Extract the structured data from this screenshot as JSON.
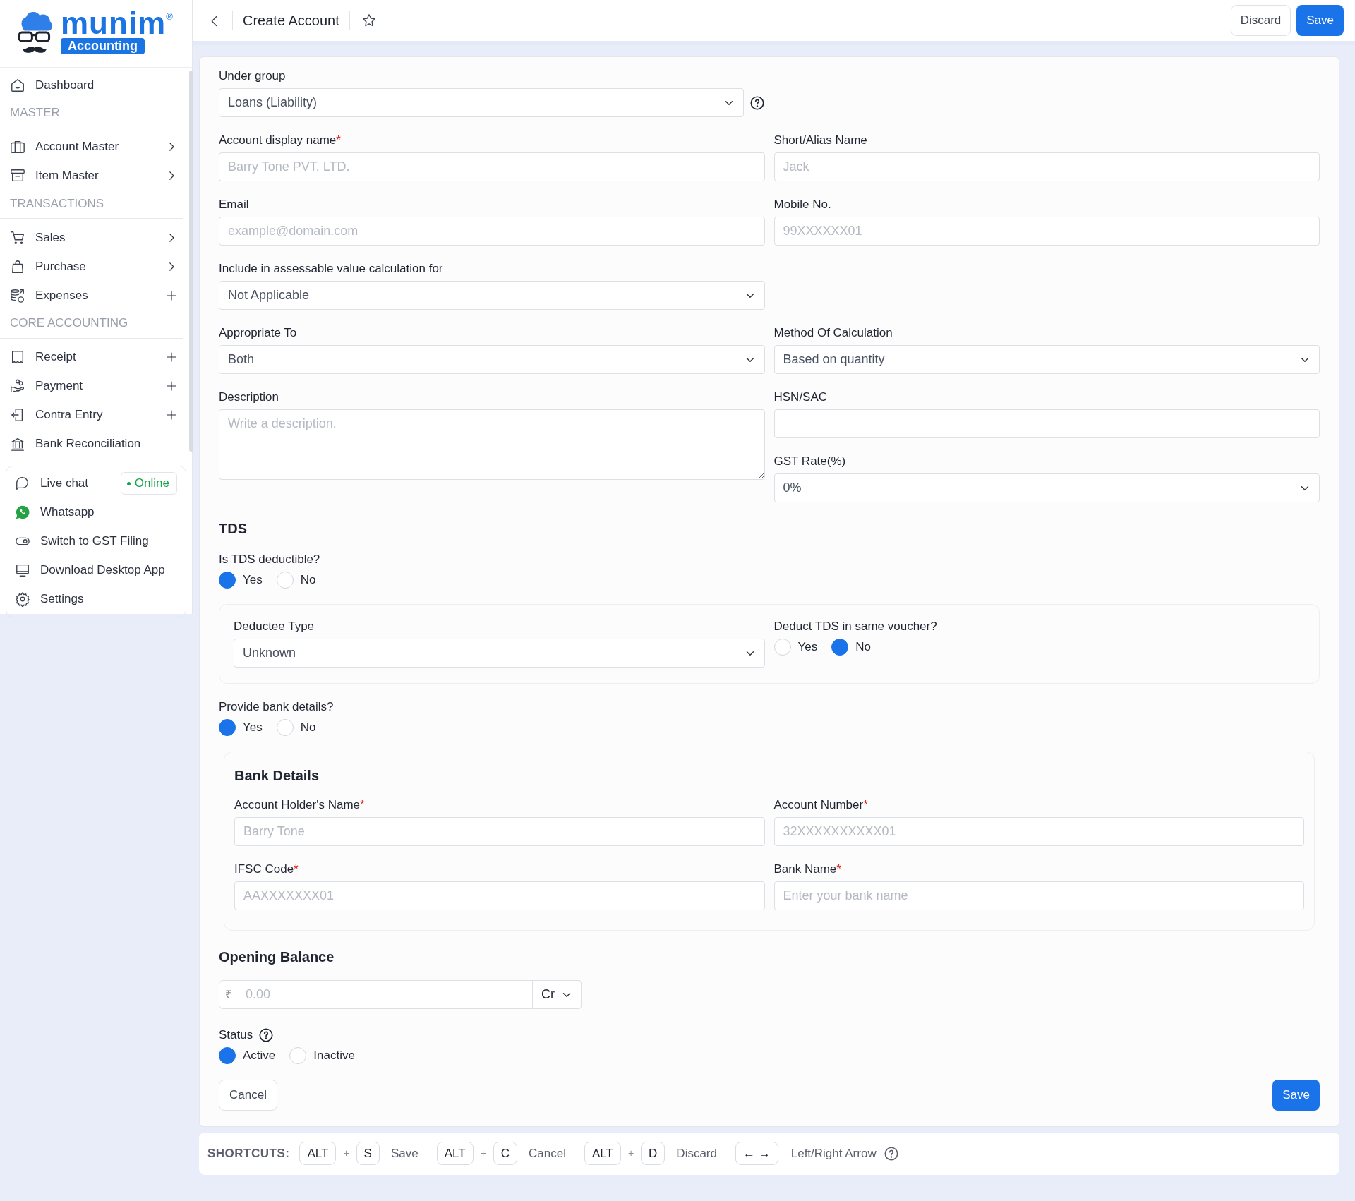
{
  "logo": {
    "wordmark": "munim",
    "registered": "®",
    "tagline": "Accounting"
  },
  "sidebar": {
    "items": [
      {
        "kind": "link",
        "label": "Dashboard"
      },
      {
        "kind": "section",
        "label": "MASTER"
      },
      {
        "kind": "link",
        "label": "Account Master",
        "submenu": true
      },
      {
        "kind": "link",
        "label": "Item Master",
        "submenu": true
      },
      {
        "kind": "section",
        "label": "TRANSACTIONS"
      },
      {
        "kind": "link",
        "label": "Sales",
        "submenu": true
      },
      {
        "kind": "link",
        "label": "Purchase",
        "submenu": true
      },
      {
        "kind": "link",
        "label": "Expenses",
        "quick_add": true
      },
      {
        "kind": "section",
        "label": "CORE ACCOUNTING"
      },
      {
        "kind": "link",
        "label": "Receipt",
        "quick_add": true
      },
      {
        "kind": "link",
        "label": "Payment",
        "quick_add": true
      },
      {
        "kind": "link",
        "label": "Contra Entry",
        "quick_add": true
      },
      {
        "kind": "link",
        "label": "Bank Reconciliation"
      }
    ],
    "support": [
      {
        "label": "Live chat",
        "badge": "Online"
      },
      {
        "label": "Whatsapp"
      },
      {
        "label": "Switch to GST Filing"
      },
      {
        "label": "Download Desktop App"
      },
      {
        "label": "Settings"
      }
    ]
  },
  "header": {
    "title": "Create Account",
    "starred": false,
    "buttons": [
      {
        "label": "Discard",
        "kind": "secondary"
      },
      {
        "label": "Save",
        "kind": "primary"
      }
    ]
  },
  "form": {
    "blocks": [
      {
        "kind": "grid",
        "rows": [
          [
            [
              {
                "kind": "select",
                "label": "Under group",
                "value": "Loans (Liability)",
                "help": true
              }
            ],
            []
          ],
          [
            [
              {
                "kind": "input",
                "label": "Account display name",
                "required_mark": "*",
                "placeholder": "Barry Tone PVT. LTD."
              }
            ],
            [
              {
                "kind": "input",
                "label": "Short/Alias Name",
                "placeholder": "Jack"
              }
            ]
          ],
          [
            [
              {
                "kind": "input",
                "label": "Email",
                "placeholder": "example@domain.com"
              }
            ],
            [
              {
                "kind": "input",
                "label": "Mobile No.",
                "placeholder": "99XXXXXX01"
              }
            ]
          ],
          [
            [
              {
                "kind": "select",
                "label": "Include in assessable value calculation for",
                "value": "Not Applicable"
              }
            ],
            []
          ],
          [
            [
              {
                "kind": "select",
                "label": "Appropriate To",
                "value": "Both"
              }
            ],
            [
              {
                "kind": "select",
                "label": "Method Of Calculation",
                "value": "Based on quantity"
              }
            ]
          ],
          [
            [
              {
                "kind": "textarea",
                "label": "Description",
                "placeholder": "Write a description."
              }
            ],
            [
              {
                "kind": "input",
                "label": "HSN/SAC"
              },
              {
                "kind": "select",
                "label": "GST Rate(%)",
                "value": "0%"
              }
            ]
          ]
        ]
      },
      {
        "kind": "heading",
        "text": "TDS"
      },
      {
        "kind": "radio",
        "label": "Is TDS deductible?",
        "options": [
          {
            "label": "Yes",
            "selected": true
          },
          {
            "label": "No",
            "selected": false
          }
        ]
      },
      {
        "kind": "panel",
        "rows": [
          [
            [
              {
                "kind": "select",
                "label": "Deductee Type",
                "value": "Unknown"
              }
            ],
            [
              {
                "kind": "radio",
                "label": "Deduct TDS in same voucher?",
                "options": [
                  {
                    "label": "Yes",
                    "selected": false
                  },
                  {
                    "label": "No",
                    "selected": true
                  }
                ]
              }
            ]
          ]
        ]
      },
      {
        "kind": "radio",
        "label": "Provide bank details?",
        "options": [
          {
            "label": "Yes",
            "selected": true
          },
          {
            "label": "No",
            "selected": false
          }
        ]
      },
      {
        "kind": "panel",
        "title": "Bank Details",
        "rows": [
          [
            [
              {
                "kind": "input",
                "label": "Account Holder's Name",
                "required_mark": "*",
                "placeholder": "Barry Tone"
              }
            ],
            [
              {
                "kind": "input",
                "label": "Account Number",
                "required_mark": "*",
                "placeholder": "32XXXXXXXXXX01"
              }
            ]
          ],
          [
            [
              {
                "kind": "input",
                "label": "IFSC Code",
                "required_mark": "*",
                "placeholder": "AAXXXXXXX01"
              }
            ],
            [
              {
                "kind": "input",
                "label": "Bank Name",
                "required_mark": "*",
                "placeholder": "Enter your bank name"
              }
            ]
          ]
        ]
      },
      {
        "kind": "heading",
        "text": "Opening Balance"
      },
      {
        "kind": "amount",
        "prefix": "₹",
        "placeholder": "0.00",
        "type_value": "Cr"
      },
      {
        "kind": "radio",
        "label": "Status",
        "help": true,
        "options": [
          {
            "label": "Active",
            "selected": true
          },
          {
            "label": "Inactive",
            "selected": false
          }
        ]
      }
    ],
    "buttons": [
      {
        "label": "Cancel",
        "kind": "secondary"
      },
      {
        "label": "Save",
        "kind": "primary"
      }
    ]
  },
  "shortcuts": {
    "label": "SHORTCUTS:",
    "items": [
      {
        "parts": [
          {
            "kind": "key",
            "text": "ALT"
          },
          {
            "kind": "plus",
            "text": "+"
          },
          {
            "kind": "key",
            "text": "S"
          }
        ],
        "label": "Save"
      },
      {
        "parts": [
          {
            "kind": "key",
            "text": "ALT"
          },
          {
            "kind": "plus",
            "text": "+"
          },
          {
            "kind": "key",
            "text": "C"
          }
        ],
        "label": "Cancel"
      },
      {
        "parts": [
          {
            "kind": "key",
            "text": "ALT"
          },
          {
            "kind": "plus",
            "text": "+"
          },
          {
            "kind": "key",
            "text": "D"
          }
        ],
        "label": "Discard"
      },
      {
        "parts": [
          {
            "kind": "key",
            "text": "← →"
          }
        ],
        "label": "Left/Right Arrow",
        "help": true
      }
    ]
  }
}
